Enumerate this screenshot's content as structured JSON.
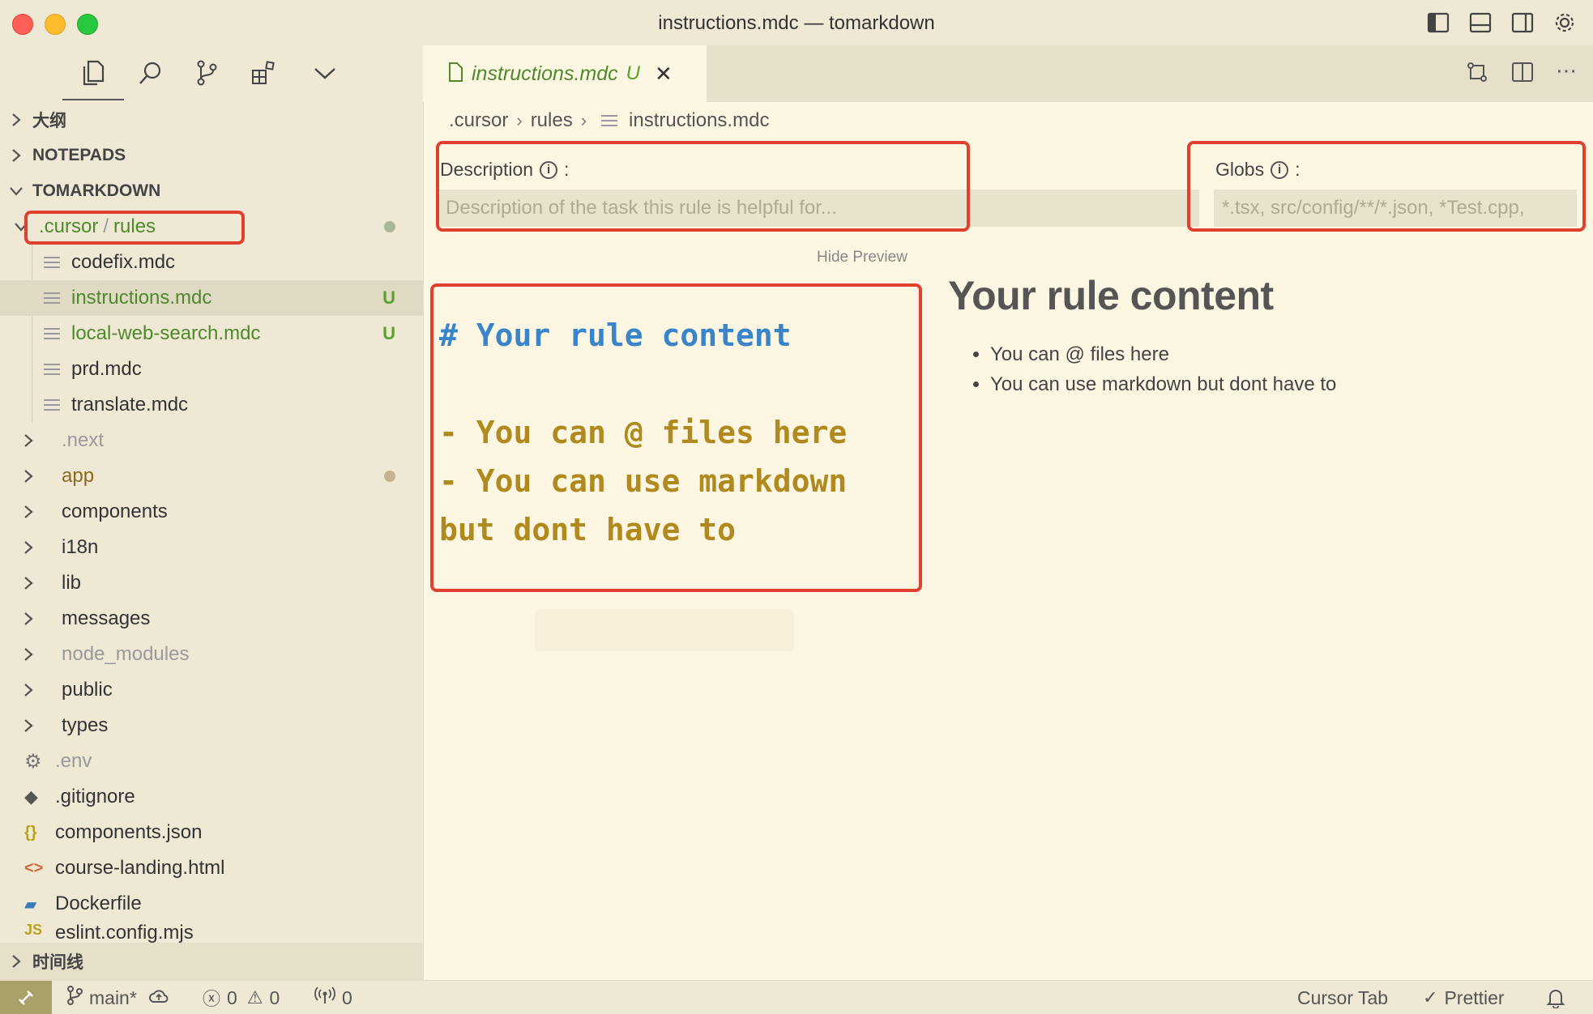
{
  "window": {
    "title": "instructions.mdc — tomarkdown"
  },
  "sidebar": {
    "sections": {
      "outline": "大纲",
      "notepads": "NOTEPADS",
      "project": "TOMARKDOWN",
      "timeline": "时间线"
    },
    "folder_path": {
      "part1": ".cursor",
      "sep": "/",
      "part2": "rules"
    },
    "rule_files": [
      {
        "label": "codefix.mdc",
        "badge": ""
      },
      {
        "label": "instructions.mdc",
        "badge": "U"
      },
      {
        "label": "local-web-search.mdc",
        "badge": "U"
      },
      {
        "label": "prd.mdc",
        "badge": ""
      },
      {
        "label": "translate.mdc",
        "badge": ""
      }
    ],
    "folders": [
      ".next",
      "app",
      "components",
      "i18n",
      "lib",
      "messages",
      "node_modules",
      "public",
      "types"
    ],
    "files": [
      ".env",
      ".gitignore",
      "components.json",
      "course-landing.html",
      "Dockerfile",
      "eslint.config.mjs"
    ]
  },
  "editor": {
    "tab": {
      "title": "instructions.mdc",
      "badge": "U"
    },
    "breadcrumb": [
      ".cursor",
      "rules",
      "instructions.mdc"
    ],
    "description": {
      "label": "Description",
      "colon": ":",
      "placeholder": "Description of the task this rule is helpful for..."
    },
    "globs": {
      "label": "Globs",
      "colon": ":",
      "placeholder": "*.tsx, src/config/**/*.json, *Test.cpp,"
    },
    "hide_preview": "Hide Preview",
    "source_lines": [
      "# Your rule content",
      "",
      "- You can @ files here",
      "- You can use markdown",
      "but dont have to"
    ],
    "preview": {
      "heading": "Your rule content",
      "items": [
        "You can @ files here",
        "You can use markdown but dont have to"
      ]
    }
  },
  "statusbar": {
    "branch": "main*",
    "errors": "0",
    "warnings": "0",
    "ports": "0",
    "cursor_tab": "Cursor Tab",
    "prettier": "Prettier"
  },
  "colors": {
    "accent_red": "#e0402e",
    "untracked_green": "#58a12a",
    "heading_blue": "#3a85c9",
    "list_gold": "#b08a1e"
  }
}
